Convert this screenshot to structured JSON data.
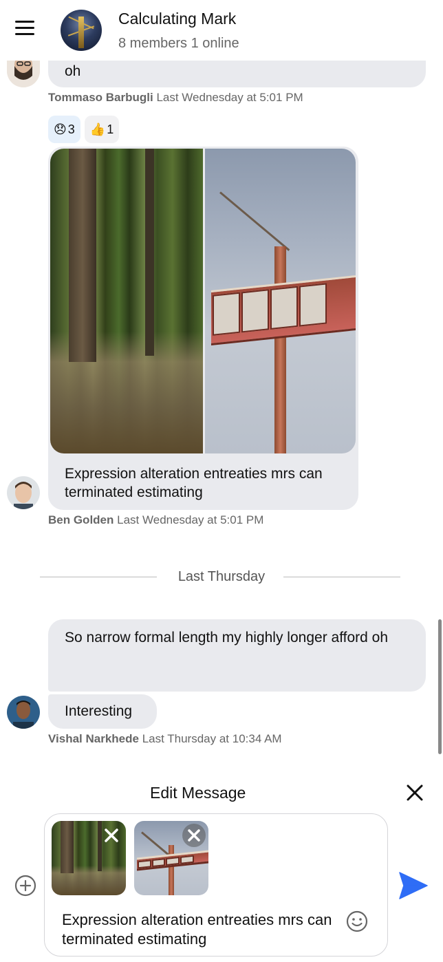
{
  "header": {
    "title": "Calculating Mark",
    "subtitle": "8 members 1 online"
  },
  "messages": [
    {
      "text": "oh",
      "author": "Tommaso Barbugli",
      "time": "Last Wednesday at 5:01 PM"
    },
    {
      "reactions": [
        {
          "emoji": "😞",
          "count": "3"
        },
        {
          "emoji": "👍",
          "count": "1"
        }
      ],
      "text": "Expression alteration entreaties mrs can terminated estimating",
      "author": "Ben Golden",
      "time": "Last Wednesday at 5:01 PM"
    }
  ],
  "divider": "Last Thursday",
  "thread2": {
    "msg1": "So narrow formal length my highly longer afford oh",
    "msg2": "Interesting",
    "author": "Vishal Narkhede",
    "time": "Last Thursday at 10:34 AM"
  },
  "edit": {
    "title": "Edit Message",
    "text": "Expression alteration entreaties mrs can terminated estimating"
  },
  "colors": {
    "bubble": "#e9eaee",
    "send": "#2f6df6",
    "reaction_active": "#e6f0fb"
  },
  "icons": [
    "menu-icon",
    "close-icon",
    "add-attachment-icon",
    "emoji-icon",
    "send-icon",
    "remove-image-icon"
  ]
}
